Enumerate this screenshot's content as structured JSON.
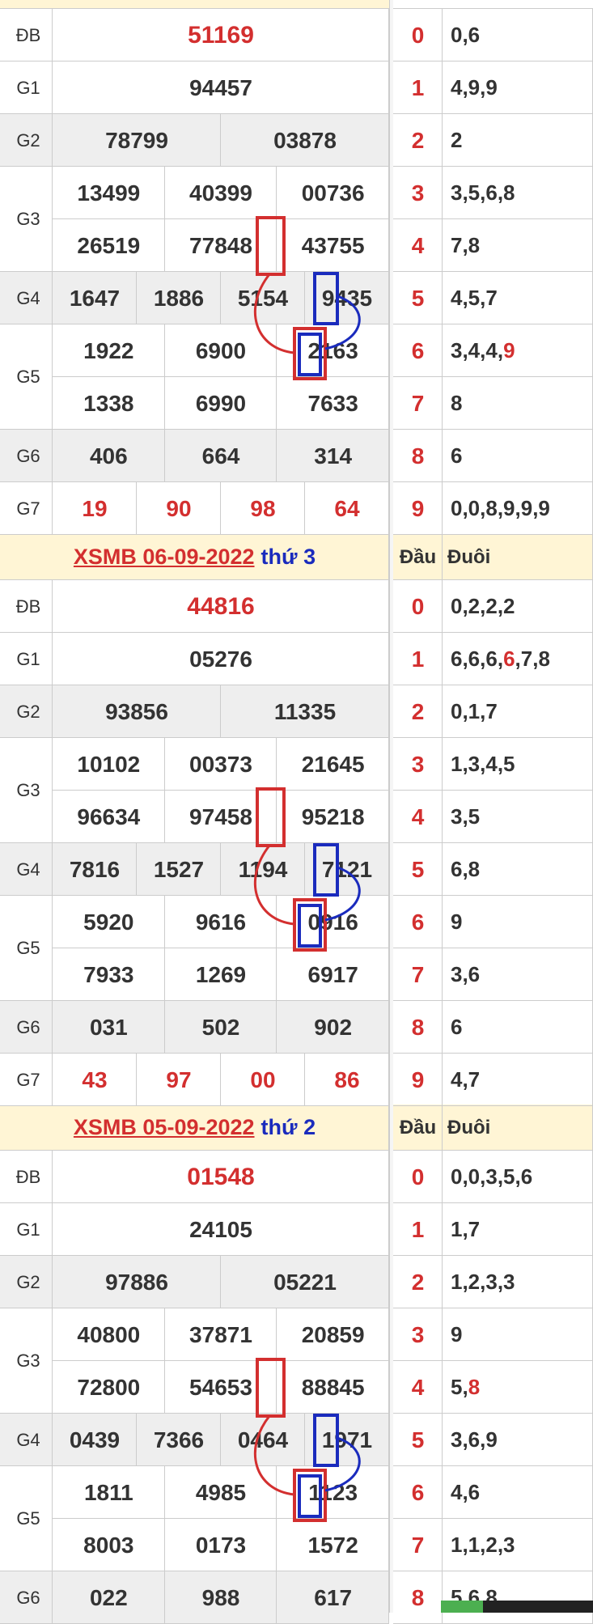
{
  "colors": {
    "red": "#d32f2f",
    "blue": "#1a2bbd",
    "header_bg": "#fff5d5",
    "gray": "#eeeeee",
    "grid": "#cccccc"
  },
  "headers": [
    {
      "title_date": "XSMB 06-09-2022",
      "title_day": "thứ 3",
      "col_head": "Đầu",
      "col_tail": "Đuôi"
    },
    {
      "title_date": "XSMB 05-09-2022",
      "title_day": "thứ 2",
      "col_head": "Đầu",
      "col_tail": "Đuôi"
    }
  ],
  "labels": {
    "db": "ĐB",
    "g1": "G1",
    "g2": "G2",
    "g3": "G3",
    "g4": "G4",
    "g5": "G5",
    "g6": "G6",
    "g7": "G7"
  },
  "draws": [
    {
      "db": "51169",
      "g1": "94457",
      "g2": [
        "78799",
        "03878"
      ],
      "g3": [
        "13499",
        "40399",
        "00736",
        "26519",
        "77848",
        "43755"
      ],
      "g4": [
        "1647",
        "1886",
        "5154",
        "9435"
      ],
      "g5": [
        "1922",
        "6900",
        "2163",
        "1338",
        "6990",
        "7633"
      ],
      "g6": [
        "406",
        "664",
        "314"
      ],
      "g7": [
        "19",
        "90",
        "98",
        "64"
      ],
      "loto": [
        {
          "head": "0",
          "tail": "0,6"
        },
        {
          "head": "1",
          "tail": "4,9,9"
        },
        {
          "head": "2",
          "tail": "2"
        },
        {
          "head": "3",
          "tail": "3,5,6,8"
        },
        {
          "head": "4",
          "tail": "7,8"
        },
        {
          "head": "5",
          "tail": "4,5,7"
        },
        {
          "head": "6",
          "tail": "3,4,4,",
          "tail_red": "9"
        },
        {
          "head": "7",
          "tail": "8"
        },
        {
          "head": "8",
          "tail": "6"
        },
        {
          "head": "9",
          "tail": "0,0,8,9,9,9"
        }
      ]
    },
    {
      "db": "44816",
      "g1": "05276",
      "g2": [
        "93856",
        "11335"
      ],
      "g3": [
        "10102",
        "00373",
        "21645",
        "96634",
        "97458",
        "95218"
      ],
      "g4": [
        "7816",
        "1527",
        "1194",
        "7121"
      ],
      "g5": [
        "5920",
        "9616",
        "0916",
        "7933",
        "1269",
        "6917"
      ],
      "g6": [
        "031",
        "502",
        "902"
      ],
      "g7": [
        "43",
        "97",
        "00",
        "86"
      ],
      "loto": [
        {
          "head": "0",
          "tail": "0,2,2,2"
        },
        {
          "head": "1",
          "tail": "6,6,6,",
          "tail_red": "6",
          "tail_after": ",7,8"
        },
        {
          "head": "2",
          "tail": "0,1,7"
        },
        {
          "head": "3",
          "tail": "1,3,4,5"
        },
        {
          "head": "4",
          "tail": "3,5"
        },
        {
          "head": "5",
          "tail": "6,8"
        },
        {
          "head": "6",
          "tail": "9"
        },
        {
          "head": "7",
          "tail": "3,6"
        },
        {
          "head": "8",
          "tail": "6"
        },
        {
          "head": "9",
          "tail": "4,7"
        }
      ]
    },
    {
      "db": "01548",
      "g1": "24105",
      "g2": [
        "97886",
        "05221"
      ],
      "g3": [
        "40800",
        "37871",
        "20859",
        "72800",
        "54653",
        "88845"
      ],
      "g4": [
        "0439",
        "7366",
        "0464",
        "1971"
      ],
      "g5": [
        "1811",
        "4985",
        "1123",
        "8003",
        "0173",
        "1572"
      ],
      "g6": [
        "022",
        "988",
        "617"
      ],
      "loto": [
        {
          "head": "0",
          "tail": "0,0,3,5,6"
        },
        {
          "head": "1",
          "tail": "1,7"
        },
        {
          "head": "2",
          "tail": "1,2,3,3"
        },
        {
          "head": "3",
          "tail": "9"
        },
        {
          "head": "4",
          "tail": "5,",
          "tail_red": "8"
        },
        {
          "head": "5",
          "tail": "3,6,9"
        },
        {
          "head": "6",
          "tail": "4,6"
        },
        {
          "head": "7",
          "tail": "1,1,2,3"
        },
        {
          "head": "8",
          "tail": "5,6,8"
        }
      ]
    }
  ]
}
